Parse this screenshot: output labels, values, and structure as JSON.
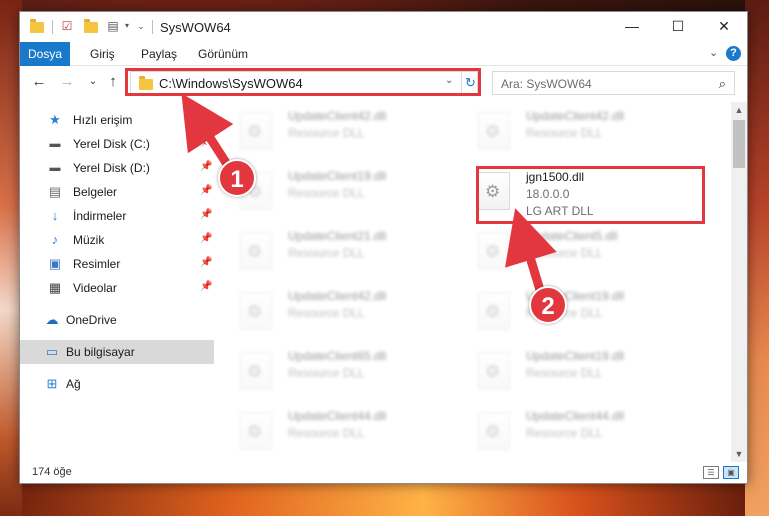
{
  "window": {
    "title": "SysWOW64",
    "minimize_glyph": "—",
    "maximize_glyph": "☐",
    "close_glyph": "✕"
  },
  "ribbon": {
    "tabs": [
      "Dosya",
      "Giriş",
      "Paylaş",
      "Görünüm"
    ],
    "file_tab_color": "#1979ca",
    "help_glyph": "?",
    "collapse_glyph": "⌄"
  },
  "address": {
    "path": "C:\\Windows\\SysWOW64",
    "dropdown_glyph": "⌄",
    "refresh_glyph": "↻"
  },
  "search": {
    "placeholder": "Ara: SysWOW64"
  },
  "nav": {
    "back_glyph": "←",
    "forward_glyph": "→",
    "recent_glyph": "⌄",
    "up_glyph": "↑",
    "items": [
      {
        "label": "Hızlı erişim",
        "icon": "star-icon",
        "pinned": false
      },
      {
        "label": "Yerel Disk (C:)",
        "icon": "drive-icon",
        "pinned": true
      },
      {
        "label": "Yerel Disk (D:)",
        "icon": "drive-icon",
        "pinned": true
      },
      {
        "label": "Belgeler",
        "icon": "documents-icon",
        "pinned": true
      },
      {
        "label": "İndirmeler",
        "icon": "download-icon",
        "pinned": true
      },
      {
        "label": "Müzik",
        "icon": "music-icon",
        "pinned": true
      },
      {
        "label": "Resimler",
        "icon": "pictures-icon",
        "pinned": true
      },
      {
        "label": "Videolar",
        "icon": "videos-icon",
        "pinned": true
      },
      {
        "label": "OneDrive",
        "icon": "cloud-icon",
        "pinned": false
      },
      {
        "label": "Bu bilgisayar",
        "icon": "computer-icon",
        "pinned": false,
        "selected": true
      },
      {
        "label": "Ağ",
        "icon": "network-icon",
        "pinned": false
      }
    ]
  },
  "files": {
    "left": [
      {
        "name": "UpdateClient42.dll",
        "type": "Resource DLL"
      },
      {
        "name": "UpdateClient19.dll",
        "type": "Resource DLL"
      },
      {
        "name": "UpdateClient21.dll",
        "type": "Resource DLL"
      },
      {
        "name": "UpdateClient42.dll",
        "type": "Resource DLL"
      },
      {
        "name": "UpdateClient65.dll",
        "type": "Resource DLL"
      },
      {
        "name": "UpdateClient44.dll",
        "type": "Resource DLL"
      }
    ],
    "right": [
      {
        "name": "UpdateClient42.dll",
        "type": "Resource DLL"
      },
      {
        "name": "UpdateClient5.dll",
        "type": "Resource DLL"
      },
      {
        "name": "UpdateClient19.dll",
        "type": "Resource DLL"
      },
      {
        "name": "UpdateClient19.dll",
        "type": "Resource DLL"
      },
      {
        "name": "UpdateClient44.dll",
        "type": "Resource DLL"
      }
    ],
    "focus": {
      "name": "jgn1500.dll",
      "version": "18.0.0.0",
      "description": "LG ART DLL"
    }
  },
  "status": {
    "count": "174 öğe"
  },
  "callouts": {
    "one": "1",
    "two": "2",
    "color": "#e2373f"
  }
}
